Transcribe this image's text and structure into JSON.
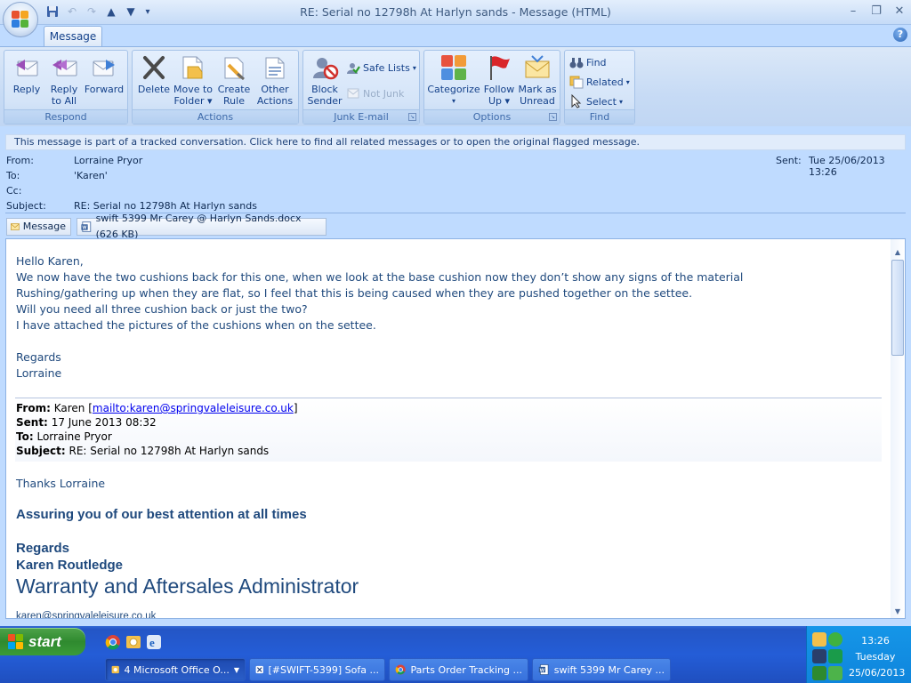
{
  "window": {
    "title": "RE: Serial no 12798h At Harlyn sands - Message (HTML)",
    "controls": {
      "minimize": "–",
      "restore": "❐",
      "close": "✕"
    },
    "help": "?"
  },
  "qat": {
    "save_icon": "save-icon",
    "undo_icon": "undo-icon",
    "redo_icon": "redo-icon",
    "up_icon": "previous-item-icon",
    "down_icon": "next-item-icon",
    "customize": "▾"
  },
  "ribbon": {
    "tab": "Message",
    "groups": {
      "respond": {
        "label": "Respond",
        "reply": "Reply",
        "reply_all_1": "Reply",
        "reply_all_2": "to All",
        "forward": "Forward"
      },
      "actions": {
        "label": "Actions",
        "delete": "Delete",
        "move_1": "Move to",
        "move_2": "Folder",
        "create_1": "Create",
        "create_2": "Rule",
        "other_1": "Other",
        "other_2": "Actions"
      },
      "junk": {
        "label": "Junk E-mail",
        "block_1": "Block",
        "block_2": "Sender",
        "safe_lists": "Safe Lists",
        "not_junk": "Not Junk"
      },
      "options": {
        "label": "Options",
        "categorize": "Categorize",
        "follow_1": "Follow",
        "follow_2": "Up",
        "mark_1": "Mark as",
        "mark_2": "Unread"
      },
      "find": {
        "label": "Find",
        "find": "Find",
        "related": "Related",
        "select": "Select"
      }
    }
  },
  "infobar": "This message is part of a tracked conversation. Click here to find all related messages or to open the original flagged message.",
  "header": {
    "from_label": "From:",
    "from": "Lorraine Pryor",
    "to_label": "To:",
    "to": "'Karen'",
    "cc_label": "Cc:",
    "cc": "",
    "subject_label": "Subject:",
    "subject": "RE: Serial no 12798h At Harlyn sands",
    "sent_label": "Sent:",
    "sent": "Tue 25/06/2013 13:26"
  },
  "attachments": {
    "message_tab": "Message",
    "file": "swift 5399 Mr Carey @ Harlyn Sands.docx (626 KB)"
  },
  "body": {
    "lines": [
      "Hello Karen,",
      "We now have the two cushions back for this one, when we look at the base cushion now they don’t show any signs of the material",
      "Rushing/gathering up when they are flat, so I feel that this is being caused when they are pushed together on the settee.",
      "Will you need all three cushion back or just the two?",
      "I have attached the pictures of the cushions when on the settee."
    ],
    "regards": "Regards",
    "signature": "Lorraine"
  },
  "quoted": {
    "from_label": "From:",
    "from_name": "Karen",
    "from_link": "mailto:karen@springvaleleisure.co.uk",
    "sent_label": "Sent:",
    "sent": "17 June 2013 08:32",
    "to_label": "To:",
    "to": "Lorraine Pryor",
    "subject_label": "Subject:",
    "subject": "RE: Serial no 12798h At Harlyn sands",
    "thanks": "Thanks Lorraine",
    "assuring": "Assuring you of our best attention at all times",
    "regards": "Regards",
    "name": "Karen Routledge",
    "role": "Warranty and Aftersales Administrator",
    "email_partial": "karen@springvaleleisure.co.uk"
  },
  "taskbar": {
    "start": "start",
    "buttons": [
      "4 Microsoft Office O...",
      "[#SWIFT-5399] Sofa ...",
      "Parts Order Tracking ...",
      "swift 5399 Mr Carey ..."
    ],
    "clock_time": "13:26",
    "clock_day": "Tuesday",
    "clock_date": "25/06/2013"
  },
  "colors": {
    "ribbon_bg": "#c7dbf5",
    "body_text": "#1f497d",
    "taskbar": "#245dd7",
    "start_green": "#3a9b38",
    "tray": "#1596e8"
  }
}
